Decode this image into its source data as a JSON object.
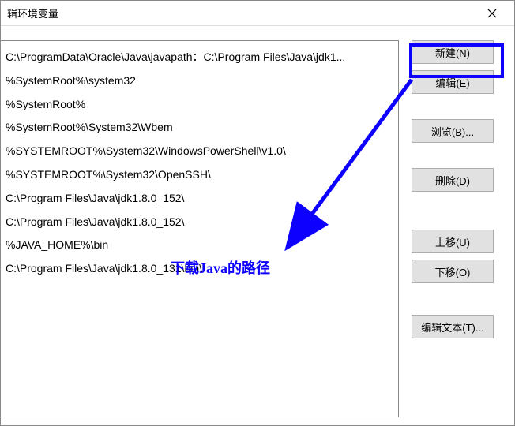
{
  "window": {
    "title": "辑环境变量"
  },
  "path_entries": [
    "C:\\ProgramData\\Oracle\\Java\\javapath：C:\\Program Files\\Java\\jdk1...",
    "%SystemRoot%\\system32",
    "%SystemRoot%",
    "%SystemRoot%\\System32\\Wbem",
    "%SYSTEMROOT%\\System32\\WindowsPowerShell\\v1.0\\",
    "%SYSTEMROOT%\\System32\\OpenSSH\\",
    "C:\\Program Files\\Java\\jdk1.8.0_152\\",
    "C:\\Program Files\\Java\\jdk1.8.0_152\\",
    "%JAVA_HOME%\\bin",
    "C:\\Program Files\\Java\\jdk1.8.0_131\\bin\\"
  ],
  "buttons": {
    "new": "新建(N)",
    "edit": "编辑(E)",
    "browse": "浏览(B)...",
    "delete": "删除(D)",
    "move_up": "上移(U)",
    "move_down": "下移(O)",
    "edit_text": "编辑文本(T)..."
  },
  "annotation": {
    "text": "下载Java的路径"
  },
  "colors": {
    "highlight": "#0d00ff"
  }
}
